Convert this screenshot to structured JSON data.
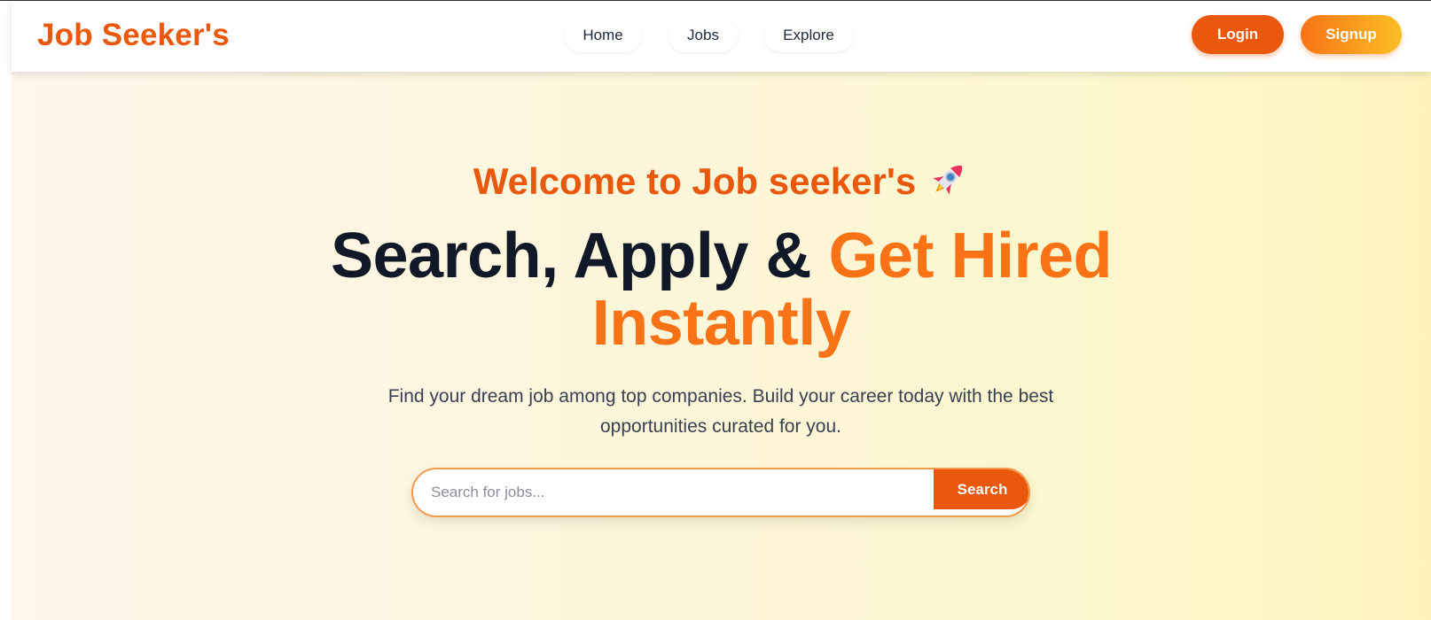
{
  "brand": {
    "name": "Job Seeker's"
  },
  "nav": {
    "links": [
      {
        "label": "Home"
      },
      {
        "label": "Jobs"
      },
      {
        "label": "Explore"
      }
    ],
    "login_label": "Login",
    "signup_label": "Signup"
  },
  "hero": {
    "welcome": "Welcome to Job seeker's",
    "welcome_icon": "rocket-icon",
    "headline_part1": "Search, Apply & ",
    "headline_accent_line1": "Get Hired",
    "headline_accent_line2": "Instantly",
    "subtext": "Find your dream job among top companies. Build your career today with the best opportunities curated for you."
  },
  "search": {
    "placeholder": "Search for jobs...",
    "value": "",
    "button_label": "Search"
  },
  "colors": {
    "brand": "#ea580c",
    "accent": "#f97316",
    "signup_gradient_end": "#fbbf24",
    "headline": "#111827",
    "body_text": "#374151"
  }
}
